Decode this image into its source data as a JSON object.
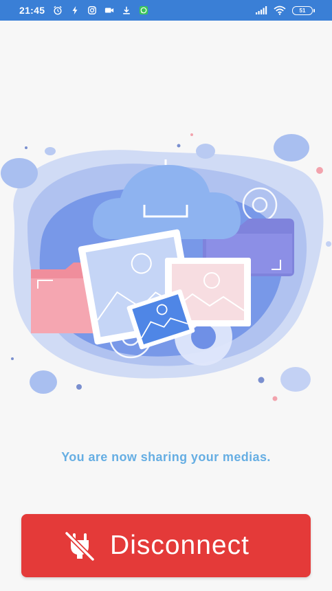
{
  "status_bar": {
    "time": "21:45",
    "battery_level": "51",
    "icons_left": [
      "alarm-icon",
      "flash-icon",
      "instagram-icon",
      "video-icon",
      "download-icon",
      "whatsapp-icon"
    ],
    "icons_right": [
      "signal-icon",
      "wifi-icon",
      "battery-icon"
    ],
    "background_color": "#3a7fd6"
  },
  "main": {
    "illustration": "media-sharing-illustration",
    "message": "You are now sharing your medias."
  },
  "disconnect": {
    "label": "Disconnect",
    "icon": "plug-off-icon",
    "background_color": "#e43a39"
  }
}
